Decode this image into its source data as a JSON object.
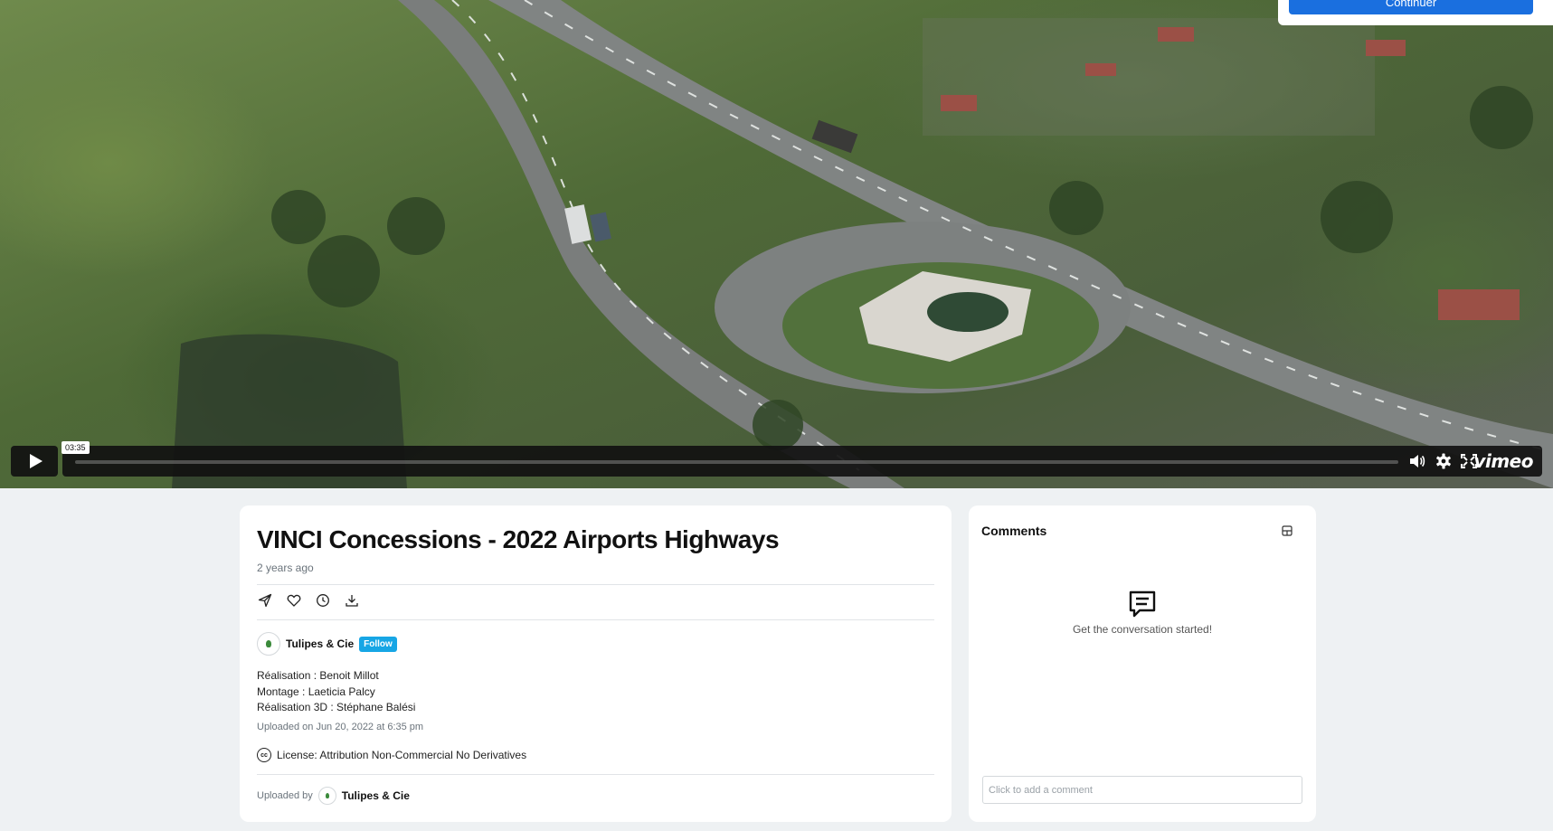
{
  "player": {
    "time_tooltip": "03:35",
    "progress_fraction": 0.0,
    "logo_text": "vimeo",
    "icons": [
      "play-icon",
      "volume-icon",
      "settings-gear-icon",
      "fullscreen-icon"
    ]
  },
  "consent": {
    "continue_label": "Continuer"
  },
  "video": {
    "title": "VINCI Concessions - 2022 Airports Highways",
    "age": "2 years ago",
    "actions": [
      "share-icon",
      "like-heart-icon",
      "watch-later-clock-icon",
      "download-icon"
    ],
    "owner": {
      "name": "Tulipes & Cie",
      "follow_label": "Follow"
    },
    "description_lines": [
      "Réalisation : Benoit Millot",
      "Montage : Laeticia Palcy",
      "Réalisation 3D : Stéphane Balési"
    ],
    "upload_date": "Uploaded on Jun 20, 2022 at 6:35 pm",
    "license_icon_text": "cc",
    "license": "License: Attribution Non-Commercial No Derivatives",
    "uploaded_by_label": "Uploaded by",
    "uploaded_by_name": "Tulipes & Cie"
  },
  "comments": {
    "title": "Comments",
    "empty_message": "Get the conversation started!",
    "input_placeholder": "Click to add a comment"
  },
  "colors": {
    "accent_blue": "#1a6fdf",
    "follow_blue": "#17a6e5",
    "page_bg": "#eef1f3"
  }
}
